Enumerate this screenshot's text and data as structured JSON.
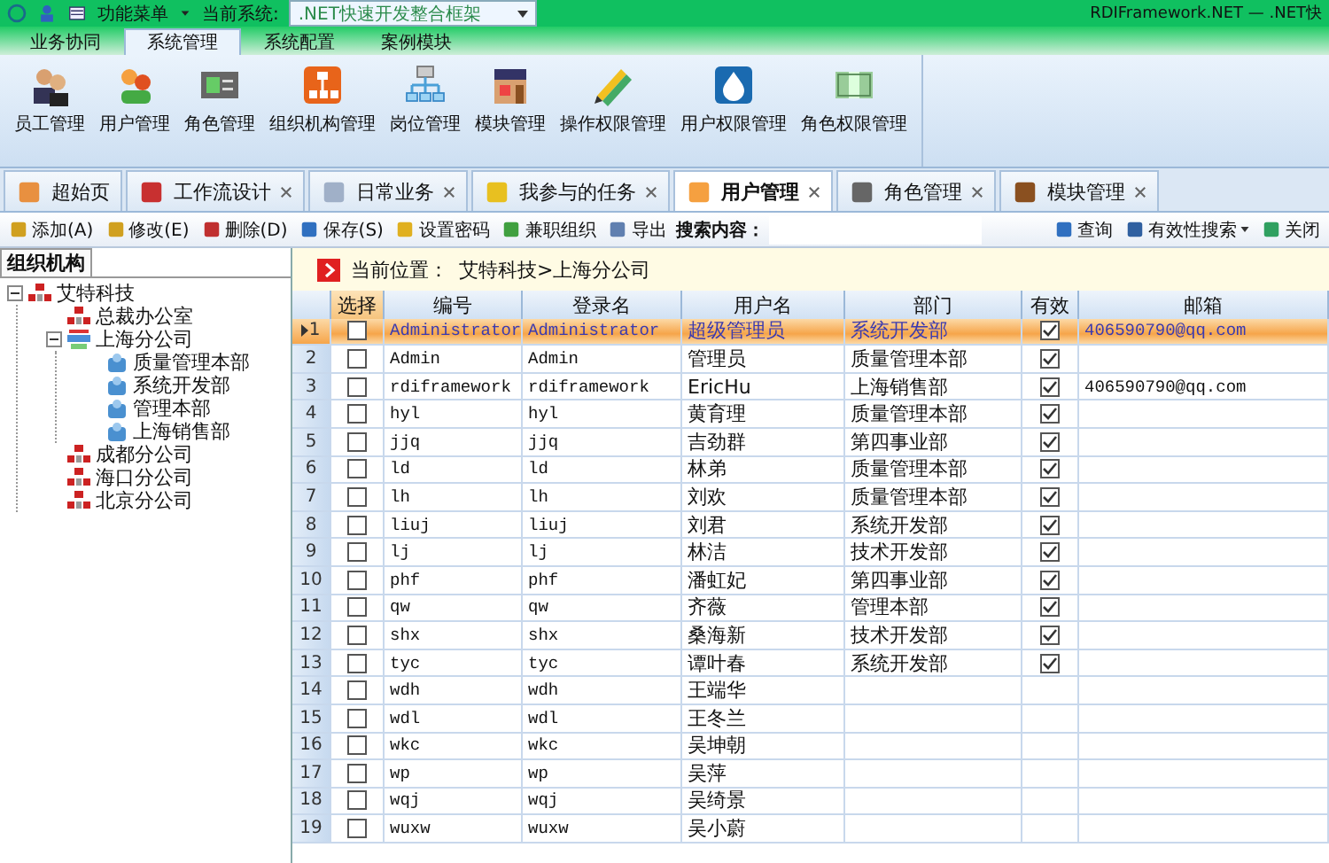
{
  "title_bar": {
    "menu_label": "功能菜单",
    "system_label": "当前系统:",
    "system_value": ".NET快速开发整合框架",
    "app_title": "RDIFramework.NET — .NET快"
  },
  "menu_tabs": [
    {
      "label": "业务协同",
      "selected": false
    },
    {
      "label": "系统管理",
      "selected": true
    },
    {
      "label": "系统配置",
      "selected": false
    },
    {
      "label": "案例模块",
      "selected": false
    }
  ],
  "ribbon": [
    "员工管理",
    "用户管理",
    "角色管理",
    "组织机构管理",
    "岗位管理",
    "模块管理",
    "操作权限管理",
    "用户权限管理",
    "角色权限管理"
  ],
  "doc_tabs": [
    {
      "label": "超始页",
      "selected": false,
      "closable": false
    },
    {
      "label": "工作流设计",
      "selected": false,
      "closable": true
    },
    {
      "label": "日常业务",
      "selected": false,
      "closable": true
    },
    {
      "label": "我参与的任务",
      "selected": false,
      "closable": true
    },
    {
      "label": "用户管理",
      "selected": true,
      "closable": true
    },
    {
      "label": "角色管理",
      "selected": false,
      "closable": true
    },
    {
      "label": "模块管理",
      "selected": false,
      "closable": true
    }
  ],
  "toolbar": [
    {
      "kind": "button",
      "label": "添加(A)"
    },
    {
      "kind": "button",
      "label": "修改(E)"
    },
    {
      "kind": "button",
      "label": "删除(D)"
    },
    {
      "kind": "button",
      "label": "保存(S)"
    },
    {
      "kind": "button",
      "label": "设置密码"
    },
    {
      "kind": "button",
      "label": "兼职组织"
    },
    {
      "kind": "button",
      "label": "导出"
    },
    {
      "kind": "label",
      "label": "搜索内容："
    },
    {
      "kind": "field"
    },
    {
      "kind": "button",
      "label": "查询"
    },
    {
      "kind": "dropdown",
      "label": "有效性搜索"
    },
    {
      "kind": "button",
      "label": "关闭"
    }
  ],
  "sidebar": {
    "title": "组织机构",
    "tree": [
      {
        "label": "艾特科技",
        "expanded": true,
        "children": [
          {
            "label": "总裁办公室"
          },
          {
            "label": "上海分公司",
            "expanded": true,
            "children": [
              {
                "label": "质量管理本部"
              },
              {
                "label": "系统开发部"
              },
              {
                "label": "管理本部"
              },
              {
                "label": "上海销售部"
              }
            ]
          },
          {
            "label": "成都分公司"
          },
          {
            "label": "海口分公司"
          },
          {
            "label": "北京分公司"
          }
        ]
      }
    ]
  },
  "location": {
    "label": "当前位置：",
    "path": "艾特科技>上海分公司"
  },
  "table": {
    "columns": [
      "选择",
      "编号",
      "登录名",
      "用户名",
      "部门",
      "有效",
      "邮箱"
    ],
    "rows": [
      {
        "num": "1",
        "selected": true,
        "checked": false,
        "code": "Administrator",
        "login": "Administrator",
        "name": "超级管理员",
        "dept": "系统开发部",
        "valid": true,
        "email": "406590790@qq.com"
      },
      {
        "num": "2",
        "selected": false,
        "checked": false,
        "code": "Admin",
        "login": "Admin",
        "name": "管理员",
        "dept": "质量管理本部",
        "valid": true
      },
      {
        "num": "3",
        "selected": false,
        "checked": false,
        "code": "rdiframework",
        "login": "rdiframework",
        "name": "EricHu",
        "dept": "上海销售部",
        "valid": true,
        "email": "406590790@qq.com"
      },
      {
        "num": "4",
        "selected": false,
        "checked": false,
        "code": "hyl",
        "login": "hyl",
        "name": "黄育理",
        "dept": "质量管理本部",
        "valid": true
      },
      {
        "num": "5",
        "selected": false,
        "checked": false,
        "code": "jjq",
        "login": "jjq",
        "name": "吉劲群",
        "dept": "第四事业部",
        "valid": true
      },
      {
        "num": "6",
        "selected": false,
        "checked": false,
        "code": "ld",
        "login": "ld",
        "name": "林弟",
        "dept": "质量管理本部",
        "valid": true
      },
      {
        "num": "7",
        "selected": false,
        "checked": false,
        "code": "lh",
        "login": "lh",
        "name": "刘欢",
        "dept": "质量管理本部",
        "valid": true
      },
      {
        "num": "8",
        "selected": false,
        "checked": false,
        "code": "liuj",
        "login": "liuj",
        "name": "刘君",
        "dept": "系统开发部",
        "valid": true
      },
      {
        "num": "9",
        "selected": false,
        "checked": false,
        "code": "lj",
        "login": "lj",
        "name": "林洁",
        "dept": "技术开发部",
        "valid": true
      },
      {
        "num": "10",
        "selected": false,
        "checked": false,
        "code": "phf",
        "login": "phf",
        "name": "潘虹妃",
        "dept": "第四事业部",
        "valid": true
      },
      {
        "num": "11",
        "selected": false,
        "checked": false,
        "code": "qw",
        "login": "qw",
        "name": "齐薇",
        "dept": "管理本部",
        "valid": true
      },
      {
        "num": "12",
        "selected": false,
        "checked": false,
        "code": "shx",
        "login": "shx",
        "name": "桑海新",
        "dept": "技术开发部",
        "valid": true
      },
      {
        "num": "13",
        "selected": false,
        "checked": false,
        "code": "tyc",
        "login": "tyc",
        "name": "谭叶春",
        "dept": "系统开发部",
        "valid": true
      },
      {
        "num": "14",
        "selected": false,
        "checked": false,
        "code": "wdh",
        "login": "wdh",
        "name": "王端华"
      },
      {
        "num": "15",
        "selected": false,
        "checked": false,
        "code": "wdl",
        "login": "wdl",
        "name": "王冬兰"
      },
      {
        "num": "16",
        "selected": false,
        "checked": false,
        "code": "wkc",
        "login": "wkc",
        "name": "吴坤朝"
      },
      {
        "num": "17",
        "selected": false,
        "checked": false,
        "code": "wp",
        "login": "wp",
        "name": "吴萍"
      },
      {
        "num": "18",
        "selected": false,
        "checked": false,
        "code": "wqj",
        "login": "wqj",
        "name": "吴绮景"
      },
      {
        "num": "19",
        "selected": false,
        "checked": false,
        "code": "wuxw",
        "login": "wuxw",
        "name": "吴小蔚"
      }
    ]
  }
}
